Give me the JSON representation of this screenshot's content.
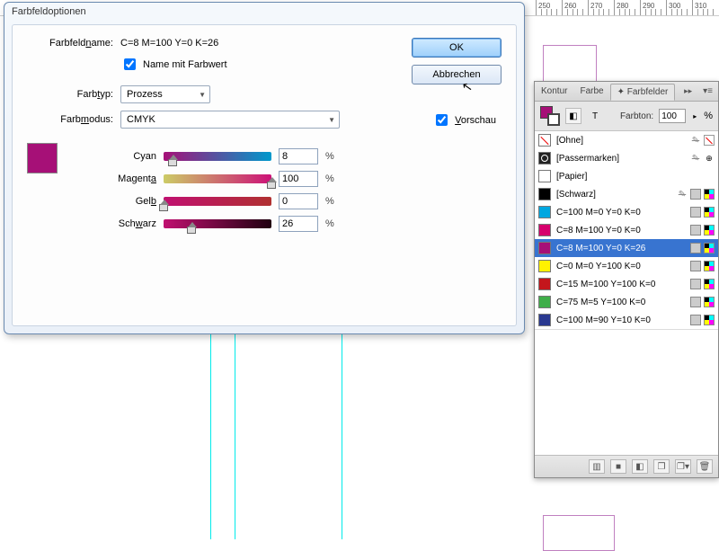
{
  "ruler": {
    "start": 250,
    "step": 10,
    "count": 8
  },
  "dialog": {
    "title": "Farbfeldoptionen",
    "name_label_pre": "Farbfeld",
    "name_label_u": "n",
    "name_label_post": "ame:",
    "name_value": "C=8 M=100 Y=0 K=26",
    "name_with_value_label": "Name mit Farbwert",
    "name_with_value_checked": true,
    "type_label_pre": "Farb",
    "type_label_u": "t",
    "type_label_post": "yp:",
    "type_value": "Prozess",
    "mode_label_pre": "Farb",
    "mode_label_u": "m",
    "mode_label_post": "odus:",
    "mode_value": "CMYK",
    "ok_label": "OK",
    "cancel_label": "Abbrechen",
    "preview_label_pre": "",
    "preview_label_u": "V",
    "preview_label_post": "orschau",
    "preview_checked": true,
    "sliders": {
      "cyan": {
        "label": "Cyan",
        "value": "8",
        "pct": "%"
      },
      "magenta": {
        "label_pre": "Magent",
        "label_u": "a",
        "label_post": "",
        "value": "100",
        "pct": "%"
      },
      "yellow": {
        "label_pre": "Gel",
        "label_u": "b",
        "label_post": "",
        "value": "0",
        "pct": "%"
      },
      "black": {
        "label_pre": "Sch",
        "label_u": "w",
        "label_post": "arz",
        "value": "26",
        "pct": "%"
      }
    }
  },
  "panel": {
    "tabs": {
      "kontur": "Kontur",
      "farbe": "Farbe",
      "farbfelder": "Farbfelder"
    },
    "tint_label": "Farbton:",
    "tint_value": "100",
    "tint_pct": "%",
    "rows": [
      {
        "name": "[Ohne]",
        "chip": "none",
        "icons": [
          "lock",
          "noedit"
        ]
      },
      {
        "name": "[Passermarken]",
        "chip": "reg",
        "icons": [
          "lock",
          "reg"
        ]
      },
      {
        "name": "[Papier]",
        "chip": "#ffffff",
        "icons": []
      },
      {
        "name": "[Schwarz]",
        "chip": "#000000",
        "icons": [
          "lock",
          "proc",
          "cmyk"
        ]
      },
      {
        "name": "C=100 M=0 Y=0 K=0",
        "chip": "#00a7e0",
        "icons": [
          "proc",
          "cmyk"
        ]
      },
      {
        "name": "C=8 M=100 Y=0 K=0",
        "chip": "#d6006d",
        "icons": [
          "proc",
          "cmyk"
        ]
      },
      {
        "name": "C=8 M=100 Y=0 K=26",
        "chip": "#a61077",
        "icons": [
          "proc",
          "cmyk"
        ],
        "selected": true
      },
      {
        "name": "C=0 M=0 Y=100 K=0",
        "chip": "#fff200",
        "icons": [
          "proc",
          "cmyk"
        ]
      },
      {
        "name": "C=15 M=100 Y=100 K=0",
        "chip": "#c4161c",
        "icons": [
          "proc",
          "cmyk"
        ]
      },
      {
        "name": "C=75 M=5 Y=100 K=0",
        "chip": "#3fae49",
        "icons": [
          "proc",
          "cmyk"
        ]
      },
      {
        "name": "C=100 M=90 Y=10 K=0",
        "chip": "#2a3990",
        "icons": [
          "proc",
          "cmyk"
        ]
      }
    ]
  }
}
